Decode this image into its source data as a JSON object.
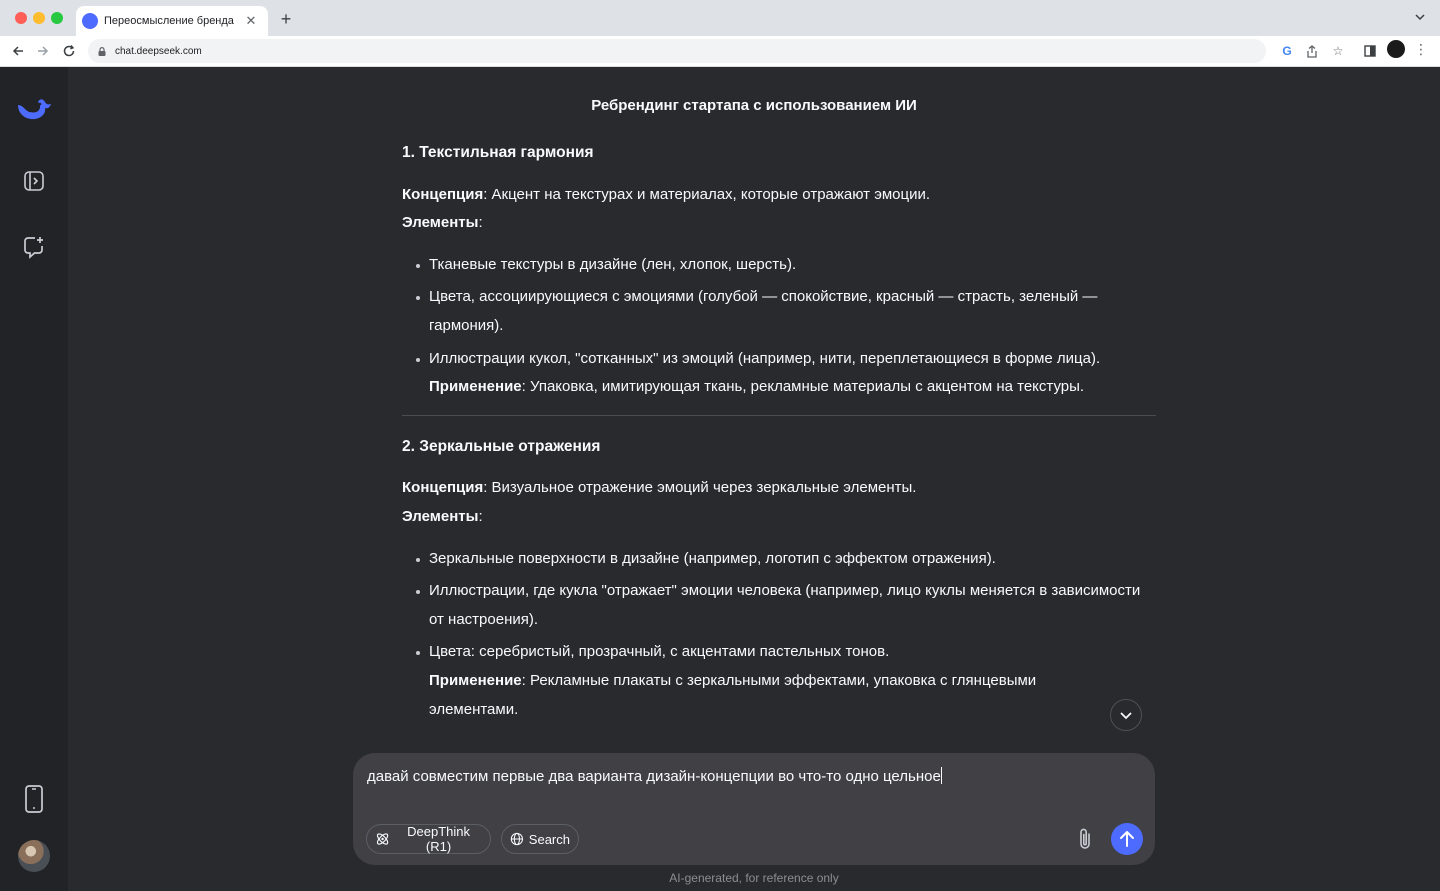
{
  "browser": {
    "tab_title": "Переосмысление бренда",
    "url": "chat.deepseek.com"
  },
  "chat": {
    "title": "Ребрендинг стартапа с использованием ИИ",
    "sections": [
      {
        "heading": "1. Текстильная гармония",
        "concept_label": "Концепция",
        "concept_text": ": Акцент на текстурах и материалах, которые отражают эмоции.",
        "elements_label": "Элементы",
        "elements_suffix": ":",
        "items": [
          "Тканевые текстуры в дизайне (лен, хлопок, шерсть).",
          "Цвета, ассоциирующиеся с эмоциями (голубой — спокойствие, красный — страсть, зеленый — гармония).",
          "Иллюстрации кукол, \"сотканных\" из эмоций (например, нити, переплетающиеся в форме лица)."
        ],
        "application_label": "Применение",
        "application_text": ": Упаковка, имитирующая ткань, рекламные материалы с акцентом на текстуры."
      },
      {
        "heading": "2. Зеркальные отражения",
        "concept_label": "Концепция",
        "concept_text": ": Визуальное отражение эмоций через зеркальные элементы.",
        "elements_label": "Элементы",
        "elements_suffix": ":",
        "items": [
          "Зеркальные поверхности в дизайне (например, логотип с эффектом отражения).",
          "Иллюстрации, где кукла \"отражает\" эмоции человека (например, лицо куклы меняется в зависимости от настроения).",
          "Цвета: серебристый, прозрачный, с акцентами пастельных тонов."
        ],
        "application_label": "Применение",
        "application_text": ": Рекламные плакаты с зеркальными эффектами, упаковка с глянцевыми элементами."
      }
    ]
  },
  "composer": {
    "input_value": "давай совместим первые два варианта дизайн-концепции во что-то одно цельное",
    "deepthink_label": "DeepThink (R1)",
    "search_label": "Search"
  },
  "footer": {
    "disclaimer": "AI-generated, for reference only"
  },
  "colors": {
    "accent": "#4d6bfe",
    "background": "#292a2d",
    "sidebar": "#212327",
    "composer": "#404045"
  }
}
